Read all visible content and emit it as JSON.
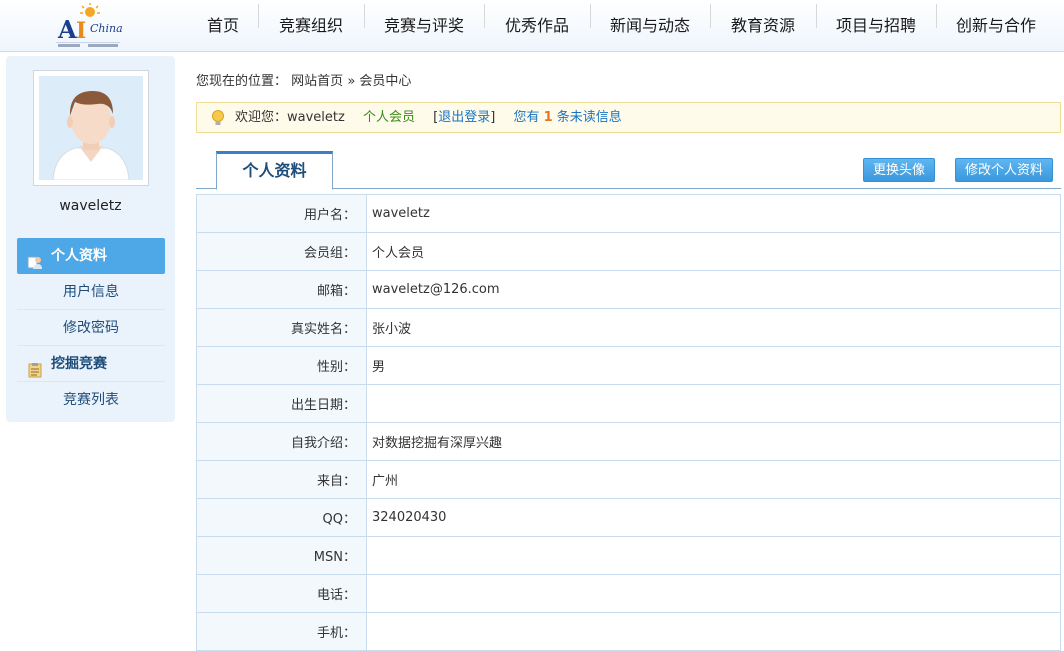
{
  "nav": {
    "items": [
      "首页",
      "竞赛组织",
      "竞赛与评奖",
      "优秀作品",
      "新闻与动态",
      "教育资源",
      "项目与招聘",
      "创新与合作"
    ]
  },
  "sidebar": {
    "username": "waveletz",
    "sections": [
      {
        "title": "个人资料",
        "icon": "user-profile-icon",
        "active": true,
        "links": [
          "用户信息",
          "修改密码"
        ]
      },
      {
        "title": "挖掘竞赛",
        "icon": "clipboard-icon",
        "active": false,
        "links": [
          "竞赛列表"
        ]
      }
    ]
  },
  "breadcrumb": {
    "prefix": "您现在的位置：",
    "home": "网站首页",
    "separator": "»",
    "current": "会员中心"
  },
  "welcome": {
    "greeting": "欢迎您：waveletz",
    "member_type": "个人会员",
    "logout_open": "[",
    "logout": "退出登录",
    "logout_close": "]",
    "msg_prefix": "您有",
    "unread_count": "1",
    "msg_suffix": "条未读信息"
  },
  "tabs": {
    "active": "个人资料",
    "change_avatar": "更换头像",
    "edit_profile": "修改个人资料"
  },
  "profile": [
    {
      "label": "用户名：",
      "value": "waveletz"
    },
    {
      "label": "会员组：",
      "value": "个人会员"
    },
    {
      "label": "邮箱：",
      "value": "waveletz@126.com"
    },
    {
      "label": "真实姓名：",
      "value": "张小波"
    },
    {
      "label": "性别：",
      "value": "男"
    },
    {
      "label": "出生日期：",
      "value": ""
    },
    {
      "label": "自我介绍：",
      "value": "对数据挖掘有深厚兴趣"
    },
    {
      "label": "来自：",
      "value": "广州"
    },
    {
      "label": "QQ：",
      "value": "324020430"
    },
    {
      "label": "MSN：",
      "value": ""
    },
    {
      "label": "电话：",
      "value": ""
    },
    {
      "label": "手机：",
      "value": ""
    }
  ],
  "colors": {
    "accent": "#4ea7e6",
    "nav_text": "#1a1a1a",
    "link": "#1a74c4",
    "highlight": "#e8761a"
  }
}
